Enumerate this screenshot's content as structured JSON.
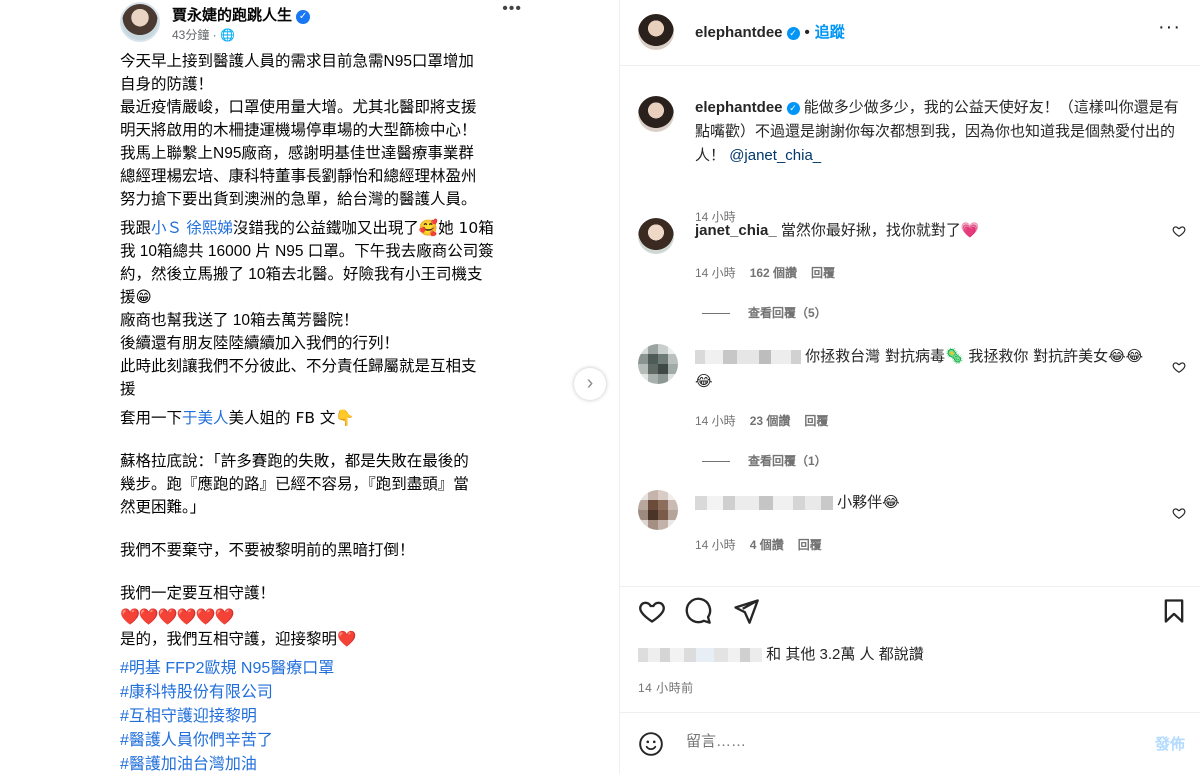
{
  "fb_post": {
    "author": "賈永婕的跑跳人生",
    "time": "43分鐘 · ",
    "more": "•••",
    "lines": [
      "今天早上接到醫護人員的需求目前急需N95口罩增加",
      "自身的防護！",
      "最近疫情嚴峻，口罩使用量大增。尤其北醫即將支援",
      "明天將啟用的木柵捷運機場停車場的大型篩檢中心！",
      "我馬上聯繫上N95廠商，感謝明基佳世達醫療事業群",
      "總經理楊宏培、康科特董事長劉靜怡和總經理林盈州",
      "努力搶下要出貨到澳洲的急單，給台灣的醫護人員。"
    ],
    "p2_a": "我跟",
    "p2_link": "小Ｓ 徐熙娣",
    "p2_b": "沒錯我的公益鐵咖又出現了🥰她 10箱",
    "p2_lines": [
      "我 10箱總共 16000 片 N95 口罩。下午我去廠商公司簽",
      "約，然後立馬搬了 10箱去北醫。好險我有小王司機支",
      "援😁",
      "廠商也幫我送了 10箱去萬芳醫院！",
      "後續還有朋友陸陸續續加入我們的行列！",
      "此時此刻讓我們不分彼此、不分責任歸屬就是互相支",
      "援"
    ],
    "p3_a": "套用一下",
    "p3_link": "于美人",
    "p3_b": "美人姐的 FB 文👇",
    "p4_lines": [
      "蘇格拉底說：「許多賽跑的失敗，都是失敗在最後的",
      "幾步。跑『應跑的路』已經不容易，『跑到盡頭』當",
      "然更困難。」"
    ],
    "p5": "我們不要棄守，不要被黎明前的黑暗打倒！",
    "p6": "我們一定要互相守護！",
    "hearts": "❤️❤️❤️❤️❤️❤️",
    "p7": "是的，我們互相守護，迎接黎明❤️",
    "hashtags": [
      "#明基 FFP2歐規 N95醫療口罩",
      "#康科特股份有限公司",
      "#互相守護迎接黎明",
      "#醫護人員你們辛苦了",
      "#醫護加油台灣加油"
    ]
  },
  "header": {
    "username": "elephantdee",
    "dot": "•",
    "follow": "追蹤",
    "more": "···"
  },
  "caption": {
    "username": "elephantdee",
    "text": "能做多少做多少，我的公益天使好友！（這樣叫你還是有點嘴歡）不過還是謝謝你每次都想到我，因為你也知道我是個熱愛付出的人！",
    "mention": "@janet_chia_",
    "time": "14 小時"
  },
  "comments": [
    {
      "username": "janet_chia_",
      "text": "當然你最好揪，找你就對了💗",
      "time": "14 小時",
      "likes": "162 個讚",
      "reply": "回覆",
      "view_replies": "查看回覆（5）"
    },
    {
      "username": "",
      "text": "你拯救台灣 對抗病毒🦠 我拯救你 對抗許美女😂😂😂",
      "time": "14 小時",
      "likes": "23 個讚",
      "reply": "回覆",
      "view_replies": "查看回覆（1）"
    },
    {
      "username": "",
      "text": "小夥伴😂",
      "time": "14 小時",
      "likes": "4 個讚",
      "reply": "回覆"
    }
  ],
  "likes_line": "和 其他 3.2萬 人 都說讚",
  "post_time": "14 小時前",
  "composer": {
    "placeholder": "留言……",
    "post": "發佈"
  },
  "colors": {
    "link_blue": "#216fdb",
    "ig_blue": "#0095f6",
    "muted": "#737373"
  }
}
